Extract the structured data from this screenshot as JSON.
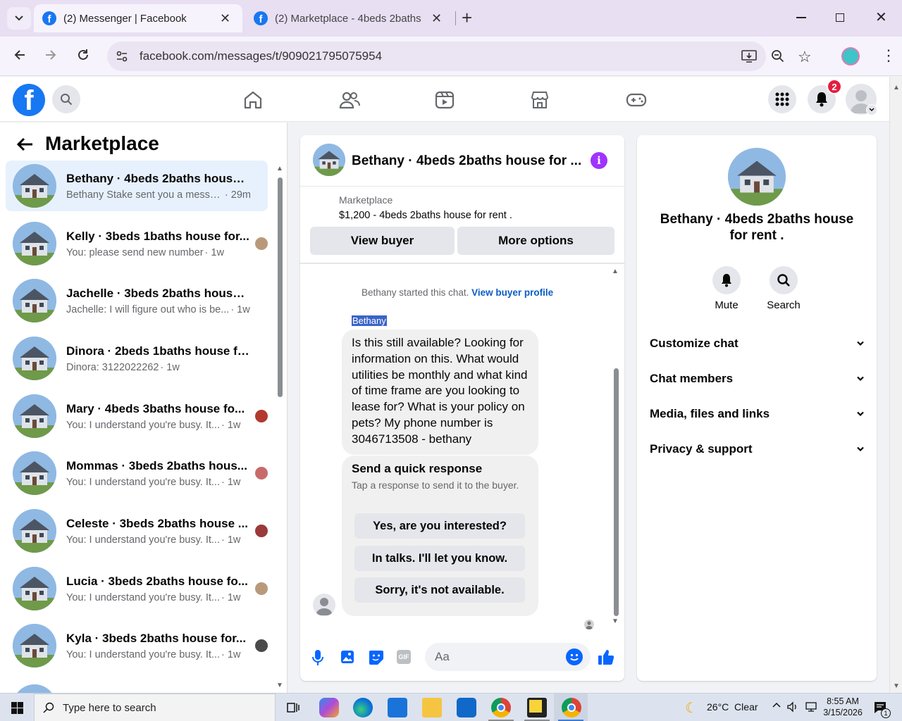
{
  "browser": {
    "tabs": [
      {
        "title": "(2) Messenger | Facebook",
        "active": true
      },
      {
        "title": "(2) Marketplace - 4beds 2baths",
        "active": false
      }
    ],
    "url": "facebook.com/messages/t/909021795075954"
  },
  "fb": {
    "notification_count": "2"
  },
  "left_panel": {
    "title": "Marketplace",
    "conversations": [
      {
        "name": "Bethany · 4beds 2baths house f...",
        "message": "Bethany Stake sent you a messag...",
        "time": "· 29m",
        "selected": true
      },
      {
        "name": "Kelly · 3beds 1baths house for...",
        "message": "You: please send new number",
        "time": "· 1w"
      },
      {
        "name": "Jachelle · 3beds 2baths house fo...",
        "message": "Jachelle: I will figure out who is be...",
        "time": "· 1w"
      },
      {
        "name": "Dinora · 2beds 1baths house for ...",
        "message": "Dinora: 3122022262",
        "time": "· 1w"
      },
      {
        "name": "Mary · 4beds 3baths house fo...",
        "message": "You: I understand you're busy. It...",
        "time": "· 1w"
      },
      {
        "name": "Mommas · 3beds 2baths hous...",
        "message": "You: I understand you're busy. It...",
        "time": "· 1w"
      },
      {
        "name": "Celeste · 3beds 2baths house ...",
        "message": "You: I understand you're busy. It...",
        "time": "· 1w"
      },
      {
        "name": "Lucia · 3beds 2baths house fo...",
        "message": "You: I understand you're busy. It...",
        "time": "· 1w"
      },
      {
        "name": "Kyla · 3beds 2baths house for...",
        "message": "You: I understand you're busy. It...",
        "time": "· 1w"
      }
    ]
  },
  "chat": {
    "title": "Bethany · 4beds 2baths house for ...",
    "listing_source": "Marketplace",
    "listing_title": "$1,200 - 4beds 2baths house for rent .",
    "view_buyer_label": "View buyer",
    "more_options_label": "More options",
    "started_text": "Bethany started this chat.",
    "view_profile_link": "View buyer profile",
    "sender_name": "Bethany",
    "message": "Is this still available? Looking for information on this. What would utilities be monthly and what kind of time frame are you looking to lease for? What is your policy on pets? My phone number is 3046713508 - bethany",
    "quick_response": {
      "title": "Send a quick response",
      "subtitle": "Tap a response to send it to the buyer.",
      "options": [
        "Yes, are you interested?",
        "In talks. I'll let you know.",
        "Sorry, it's not available."
      ]
    },
    "composer_placeholder": "Aa"
  },
  "right_panel": {
    "title": "Bethany · 4beds 2baths house for rent .",
    "mute_label": "Mute",
    "search_label": "Search",
    "sections": [
      "Customize chat",
      "Chat members",
      "Media, files and links",
      "Privacy & support"
    ]
  },
  "taskbar": {
    "search_placeholder": "Type here to search",
    "weather": "26°C  Clear",
    "time": "8:55 AM",
    "date": "3/15/2026",
    "notification_badge": "1"
  },
  "colors": {
    "fb_blue": "#1877f2",
    "accent_purple": "#a033ff",
    "selected_bg": "#e7f1fd",
    "tab_bar": "#e8dff3"
  }
}
